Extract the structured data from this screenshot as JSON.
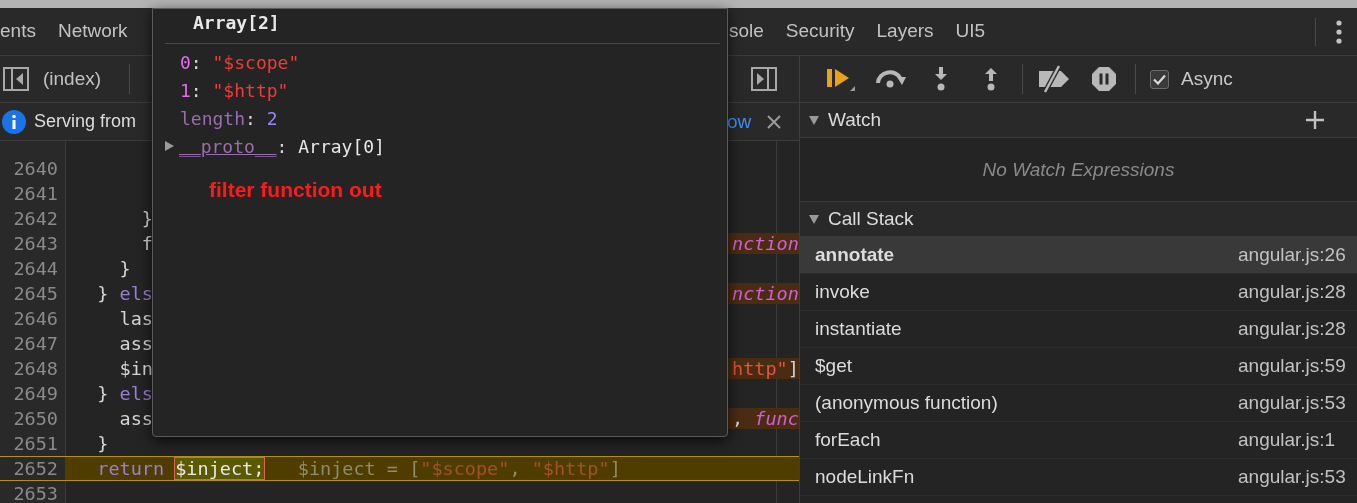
{
  "tabs": [
    {
      "label": "ents",
      "selected": false
    },
    {
      "label": "Network",
      "selected": false
    },
    {
      "label": "sole",
      "selected": false
    },
    {
      "label": "Security",
      "selected": false
    },
    {
      "label": "Layers",
      "selected": false
    },
    {
      "label": "UI5",
      "selected": false
    }
  ],
  "source_toolbar": {
    "file": "(index)"
  },
  "info_bar": {
    "message": "Serving from",
    "link": "ow"
  },
  "code_lines": [
    {
      "number": "2640",
      "current": false
    },
    {
      "number": "2641",
      "current": false
    },
    {
      "number": "2642",
      "current": false,
      "left": [
        {
          "text": "      }",
          "kind": "plain"
        }
      ]
    },
    {
      "number": "2643",
      "current": false,
      "left": [
        {
          "text": "      f",
          "kind": "plain"
        }
      ],
      "right": [
        {
          "text": "nction",
          "kind": "function"
        }
      ]
    },
    {
      "number": "2644",
      "current": false,
      "left": [
        {
          "text": "    }",
          "kind": "plain"
        }
      ]
    },
    {
      "number": "2645",
      "current": false,
      "left": [
        {
          "text": "  } ",
          "kind": "plain"
        },
        {
          "text": "els",
          "kind": "keyword"
        }
      ],
      "right": [
        {
          "text": "nction",
          "kind": "function"
        }
      ]
    },
    {
      "number": "2646",
      "current": false,
      "left": [
        {
          "text": "    las",
          "kind": "plain"
        }
      ]
    },
    {
      "number": "2647",
      "current": false,
      "left": [
        {
          "text": "    ass",
          "kind": "plain"
        }
      ]
    },
    {
      "number": "2648",
      "current": false,
      "left": [
        {
          "text": "    $in",
          "kind": "plain"
        }
      ],
      "right": [
        {
          "text": "http\"",
          "kind": "string"
        },
        {
          "text": "]",
          "kind": "plain"
        }
      ]
    },
    {
      "number": "2649",
      "current": false,
      "left": [
        {
          "text": "  } ",
          "kind": "plain"
        },
        {
          "text": "els",
          "kind": "keyword"
        }
      ]
    },
    {
      "number": "2650",
      "current": false,
      "left": [
        {
          "text": "    ass",
          "kind": "plain"
        }
      ],
      "right": [
        {
          "text": ", ",
          "kind": "plain"
        },
        {
          "text": "func",
          "kind": "function"
        }
      ]
    },
    {
      "number": "2651",
      "current": false,
      "left": [
        {
          "text": "  }",
          "kind": "plain"
        }
      ]
    },
    {
      "number": "2652",
      "current": true,
      "left": [
        {
          "text": "  return ",
          "kind": "keyword"
        },
        {
          "text": "$inject;",
          "kind": "evaluated"
        },
        {
          "text": "   $inject = [",
          "kind": "hint"
        },
        {
          "text": "\"$scope\"",
          "kind": "hint-string"
        },
        {
          "text": ", ",
          "kind": "hint"
        },
        {
          "text": "\"$http\"",
          "kind": "hint-string"
        },
        {
          "text": "]",
          "kind": "hint"
        }
      ]
    },
    {
      "number": "2653",
      "current": false
    }
  ],
  "popup": {
    "title": "Array[2]",
    "properties": [
      {
        "key": "0",
        "separator": ":",
        "kind": "element",
        "value": "\"$scope\""
      },
      {
        "key": "1",
        "separator": ":",
        "kind": "element",
        "value": "\"$http\""
      },
      {
        "key": "length",
        "separator": ":",
        "kind": "property",
        "value": "2"
      },
      {
        "key": "__proto__",
        "separator": ":",
        "kind": "prototype",
        "value": "Array[0]"
      }
    ],
    "annotation": "filter function out"
  },
  "debugger": {
    "async": {
      "label": "Async",
      "checked": true
    },
    "watch": {
      "title": "Watch",
      "expanded": true,
      "empty_text": "No Watch Expressions"
    },
    "call_stack": {
      "title": "Call Stack",
      "expanded": true,
      "frames": [
        {
          "name": "annotate",
          "location": "angular.js:26",
          "selected": true
        },
        {
          "name": "invoke",
          "location": "angular.js:28",
          "selected": false
        },
        {
          "name": "instantiate",
          "location": "angular.js:28",
          "selected": false
        },
        {
          "name": "$get",
          "location": "angular.js:59",
          "selected": false
        },
        {
          "name": "(anonymous function)",
          "location": "angular.js:53",
          "selected": false
        },
        {
          "name": "forEach",
          "location": "angular.js:1",
          "selected": false
        },
        {
          "name": "nodeLinkFn",
          "location": "angular.js:53",
          "selected": false
        }
      ]
    }
  }
}
